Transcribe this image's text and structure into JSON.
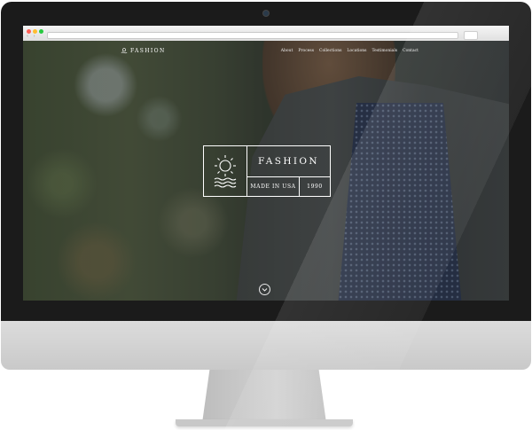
{
  "site": {
    "logo_text": "FASHION",
    "nav": [
      {
        "label": "About"
      },
      {
        "label": "Process"
      },
      {
        "label": "Collections"
      },
      {
        "label": "Locations"
      },
      {
        "label": "Testimonials"
      },
      {
        "label": "Contact"
      }
    ]
  },
  "hero": {
    "title": "FASHION",
    "subtitle": "MADE IN USA",
    "year": "1990"
  },
  "icons": {
    "logo": "sun-wave-logo-icon",
    "badge": "sun-over-waves-icon",
    "scroll": "chevron-down-circle-icon"
  },
  "colors": {
    "bezel": "#1b1b1b",
    "chin": "#d0d0d0",
    "overlay_text": "#ffffff"
  }
}
